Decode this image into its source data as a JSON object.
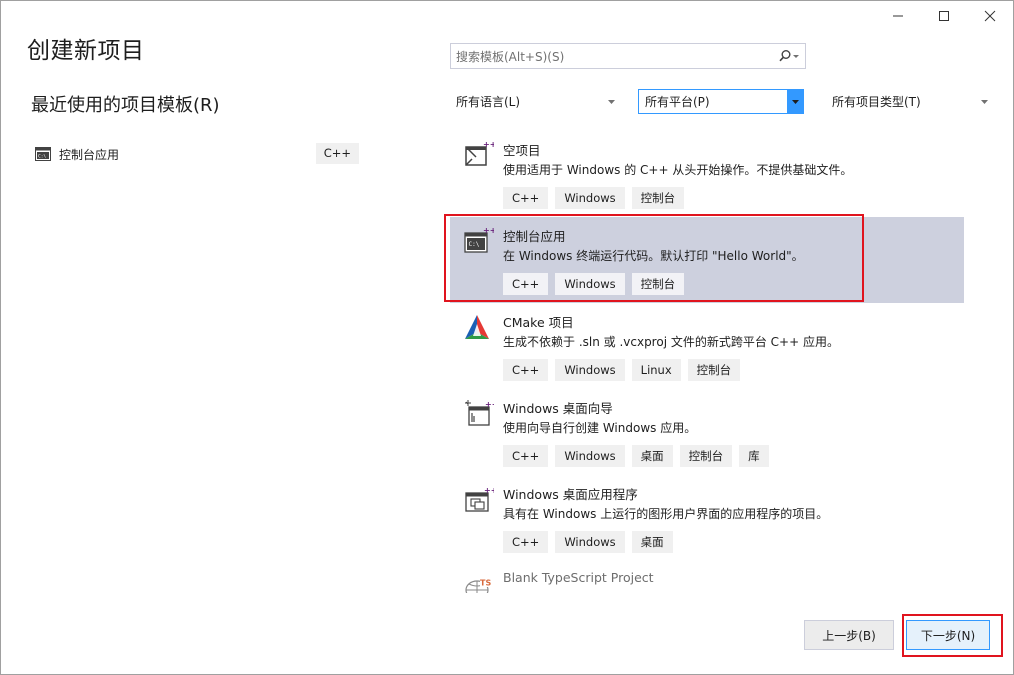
{
  "window": {
    "title": "创建新项目",
    "controls": {
      "minimize": "—",
      "maximize": "☐",
      "close": "✕"
    }
  },
  "recent": {
    "title": "最近使用的项目模板(R)",
    "items": [
      {
        "label": "控制台应用",
        "tag": "C++"
      }
    ]
  },
  "search": {
    "placeholder": "搜索模板(Alt+S)(S)"
  },
  "filters": {
    "language": "所有语言(L)",
    "platform": "所有平台(P)",
    "project_type": "所有项目类型(T)"
  },
  "templates": [
    {
      "name": "空项目",
      "description": "使用适用于 Windows 的 C++ 从头开始操作。不提供基础文件。",
      "tags": [
        "C++",
        "Windows",
        "控制台"
      ],
      "icon": "empty-project-icon",
      "selected": false
    },
    {
      "name": "控制台应用",
      "description": "在 Windows 终端运行代码。默认打印 \"Hello World\"。",
      "tags": [
        "C++",
        "Windows",
        "控制台"
      ],
      "icon": "console-app-icon",
      "selected": true
    },
    {
      "name": "CMake 项目",
      "description": "生成不依赖于 .sln 或 .vcxproj 文件的新式跨平台 C++ 应用。",
      "tags": [
        "C++",
        "Windows",
        "Linux",
        "控制台"
      ],
      "icon": "cmake-icon",
      "selected": false
    },
    {
      "name": "Windows 桌面向导",
      "description": "使用向导自行创建 Windows 应用。",
      "tags": [
        "C++",
        "Windows",
        "桌面",
        "控制台",
        "库"
      ],
      "icon": "desktop-wizard-icon",
      "selected": false
    },
    {
      "name": "Windows 桌面应用程序",
      "description": "具有在 Windows 上运行的图形用户界面的应用程序的项目。",
      "tags": [
        "C++",
        "Windows",
        "桌面"
      ],
      "icon": "desktop-app-icon",
      "selected": false
    },
    {
      "name": "Blank TypeScript Project",
      "description": "",
      "tags": [],
      "icon": "typescript-project-icon",
      "selected": false
    }
  ],
  "buttons": {
    "back": "上一步(B)",
    "next": "下一步(N)"
  },
  "colors": {
    "selection": "#cdd0de",
    "accent": "#3399ff",
    "highlight": "#e0141e",
    "cmake_red": "#e53935",
    "cmake_green": "#2e9b46",
    "cmake_blue": "#1b5fb5",
    "plus_purple": "#68217a"
  }
}
